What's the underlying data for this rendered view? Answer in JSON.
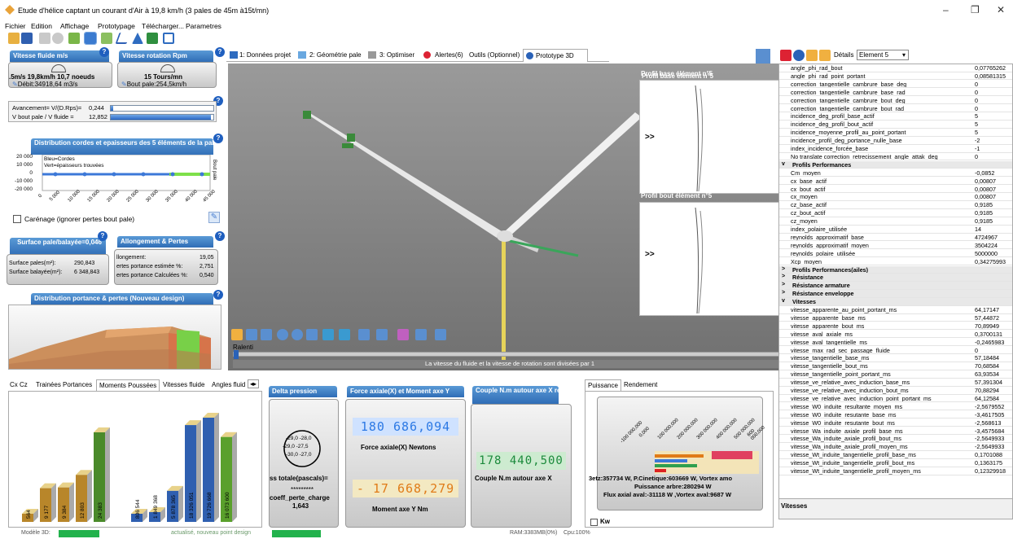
{
  "window": {
    "title": "Etude d'hélice captant un courant d'Air à 19,8 km/h (3 pales de 45m à15t/mn)",
    "minimize": "–",
    "maximize": "❐",
    "close": "✕"
  },
  "menu": [
    "Fichier",
    "Edition",
    "Affichage",
    "Prototypage",
    "Télécharger...",
    "Parametres"
  ],
  "left": {
    "fluid_speed": {
      "title": "Vitesse fluide m/s",
      "line1": ".5m/s 19,8km/h 10,7 noeuds",
      "line2": "Débit:34918,64 m3/s"
    },
    "rot_speed": {
      "title": "Vitesse rotation Rpm",
      "line1": "15 Tours/mn",
      "line2": "Bout pale:254,5km/h"
    },
    "avancement": {
      "label": "Avancement= V/(D.Rps)=",
      "value": "0,244",
      "fill": 0.02
    },
    "vbout": {
      "label": "V bout pale / V fluide =",
      "value": "12,852",
      "fill": 0.98
    },
    "dist_chart": {
      "title": "Distribution cordes et epaisseurs des  5 éléments de la pale decrits par 6 Profils",
      "legend1": "Bleu=Cordes",
      "legend2": "Vert=épaisseurs trouvées",
      "ylabel_right": "Bout pale",
      "yticks": [
        "20 000",
        "10 000",
        "0",
        "-10 000",
        "-20 000"
      ],
      "xticks": [
        "0",
        "5 000",
        "10 000",
        "15 000",
        "20 000",
        "25 000",
        "30 000",
        "35 000",
        "40 000",
        "45 000"
      ]
    },
    "carenage": "Carénage (ignorer pertes bout pale)",
    "surface": {
      "title": "Surface pale/balayée=0,046",
      "pales_label": "Surface pales(m²):",
      "pales_value": "290,843",
      "balayee_label": "Surface balayée(m²):",
      "balayee_value": "6 348,843"
    },
    "allongement": {
      "title": "Allongement & Pertes",
      "l1_label": "llongement:",
      "l1_value": "19,05",
      "l2_label": "ertes portance estimée %:",
      "l2_value": "2,751",
      "l3_label": "ertes portance Calculées %:",
      "l3_value": "0,540"
    },
    "portance": {
      "title": "Distribution portance & pertes (Nouveau design)"
    }
  },
  "tabs_main": [
    {
      "label": "1: Données projet"
    },
    {
      "label": "2: Géométrie pale"
    },
    {
      "label": "3: Optimiser"
    },
    {
      "label": "Alertes(6)"
    },
    {
      "label": "Outils (Optionnel)"
    },
    {
      "label": "Prototype 3D"
    }
  ],
  "viewport": {
    "profil_base": "Profil base élément n°5",
    "profil_bout": "Profil bout élément n°5",
    "arrows": ">>",
    "ralenti": "Ralenti",
    "message": "La vitesse du fluide et la vitesse de rotation sont divisées par 1"
  },
  "bottom_tabs": [
    "Cx Cz",
    "Trainées Portances",
    "Moments Poussées",
    "Vitesses fluide",
    "Angles fluid"
  ],
  "bars": {
    "labels": [
      "564",
      "9 177",
      "9 384",
      "12 803",
      "24 383",
      "806 544",
      "1 849 368",
      "5 878 365",
      "18 326 051",
      "19 726 668",
      "16 073 600"
    ],
    "values": [
      564,
      9177,
      9384,
      12803,
      24383,
      806544,
      1849368,
      5878365,
      18326051,
      19726668,
      16073600
    ]
  },
  "delta": {
    "title": "Delta pression",
    "v1": "-29,0 -28,0",
    "v2": "-29,0 -27,5",
    "v3": "-30,0 -27,0",
    "ss": "ss totale(pascals)=",
    "stars": "*********",
    "coeff": "coeff_perte_charge",
    "coeff_val": "1,643"
  },
  "force": {
    "title": "Force axiale(X) et Moment axe Y",
    "force_val": "180 686,094",
    "force_label": "Force axiale(X) Newtons",
    "moment_val": "- 17 668,279",
    "moment_label": "Moment axe Y Nm"
  },
  "couple": {
    "title": "Couple N.m autour axe X relatif au sens rotation",
    "value": "178 440,500",
    "label": "Couple N.m autour axe X"
  },
  "puissance": {
    "tabs": [
      "Puissance",
      "Rendement"
    ],
    "ticks": [
      "-100 000,000",
      "0,000",
      "100 000,000",
      "200 000,000",
      "300 000,000",
      "400 000,000",
      "500 000,000",
      "600 000,000"
    ],
    "l1": "3etz:357734 W, P.Cinetique:603669 W, Vortex amo",
    "l2": "Puissance arbre:280294 W",
    "l3": "Flux axial aval:-31118 W ,Vortex aval:9687 W",
    "kw": "Kw"
  },
  "props": {
    "details": "Détails",
    "element": "Element 5",
    "footer": "Vitesses",
    "rows": [
      {
        "k": "angle_phi_rad_bout",
        "v": "0,07765262"
      },
      {
        "k": "angle_phi_rad_point_portant",
        "v": "0,08581315"
      },
      {
        "k": "correction_tangentielle_cambrure_base_deg",
        "v": "0"
      },
      {
        "k": "correction_tangentielle_cambrure_base_rad",
        "v": "0"
      },
      {
        "k": "correction_tangentielle_cambrure_bout_deg",
        "v": "0"
      },
      {
        "k": "correction_tangentielle_cambrure_bout_rad",
        "v": "0"
      },
      {
        "k": "incidence_deg_profil_base_actif",
        "v": "5"
      },
      {
        "k": "incidence_deg_profil_bout_actif",
        "v": "5"
      },
      {
        "k": "incidence_moyenne_profil_au_point_portant",
        "v": "5"
      },
      {
        "k": "incidence_profil_deg_portance_nulle_base",
        "v": "-2"
      },
      {
        "k": "index_incidence_forcée_base",
        "v": "-1"
      },
      {
        "k": "No translate correction_retrecissement_angle_attak_deg",
        "v": "0"
      },
      {
        "cat": true,
        "exp": "v",
        "k": "Profils Performances"
      },
      {
        "k": "Cm_moyen",
        "v": "-0,0852"
      },
      {
        "k": "cx_base_actif",
        "v": "0,00807"
      },
      {
        "k": "cx_bout_actif",
        "v": "0,00807"
      },
      {
        "k": "cx_moyen",
        "v": "0,00807"
      },
      {
        "k": "cz_base_actif",
        "v": "0,9185"
      },
      {
        "k": "cz_bout_actif",
        "v": "0,9185"
      },
      {
        "k": "cz_moyen",
        "v": "0,9185"
      },
      {
        "k": "index_polaire_utilisée",
        "v": "14"
      },
      {
        "k": "reynolds_approximatif_base",
        "v": "4724967"
      },
      {
        "k": "reynolds_approximatif_moyen",
        "v": "3504224"
      },
      {
        "k": "reynolds_polaire_utilisée",
        "v": "5000000"
      },
      {
        "k": "Xcp_moyen",
        "v": "0,34275993"
      },
      {
        "cat": true,
        "exp": ">",
        "k": "Profils Performances(ailes)"
      },
      {
        "cat": true,
        "exp": ">",
        "k": "Résistance"
      },
      {
        "cat": true,
        "exp": ">",
        "k": "Résistance armature"
      },
      {
        "cat": true,
        "exp": ">",
        "k": "Résistance enveloppe"
      },
      {
        "cat": true,
        "exp": "v",
        "k": "Vitesses"
      },
      {
        "k": "vitesse_apparente_au_point_portant_ms",
        "v": "64,17147"
      },
      {
        "k": "vitesse_apparente_base_ms",
        "v": "57,44872"
      },
      {
        "k": "vitesse_apparente_bout_ms",
        "v": "70,89949"
      },
      {
        "k": "vitesse_aval_axiale_ms",
        "v": "0,3700131"
      },
      {
        "k": "vitesse_aval_tangentielle_ms",
        "v": "-0,2465983"
      },
      {
        "k": "vitesse_max_rad_sec_passage_fluide",
        "v": "0"
      },
      {
        "k": "vitesse_tangentielle_base_ms",
        "v": "57,18484"
      },
      {
        "k": "vitesse_tangentielle_bout_ms",
        "v": "70,68584"
      },
      {
        "k": "vitesse_tangentielle_point_portant_ms",
        "v": "63,93534"
      },
      {
        "k": "vitesse_ve_relative_avec_induction_base_ms",
        "v": "57,391304"
      },
      {
        "k": "vitesse_ve_relative_avec_induction_bout_ms",
        "v": "70,88294"
      },
      {
        "k": "vitesse_ve_relative_avec_induction_point_portant_ms",
        "v": "64,12584"
      },
      {
        "k": "vitesse_W0_induite_resultante_moyen_ms",
        "v": "-2,5679552"
      },
      {
        "k": "vitesse_W0_induite_resutante_base_ms",
        "v": "-3,4617505"
      },
      {
        "k": "vitesse_W0_induite_resutante_bout_ms",
        "v": "-2,568613"
      },
      {
        "k": "vitesse_Wa_induite_axiale_profil_base_ms",
        "v": "-3,4575684"
      },
      {
        "k": "vitesse_Wa_induite_axiale_profil_bout_ms",
        "v": "-2,5649933"
      },
      {
        "k": "vitesse_Wa_induite_axiale_profil_moyen_ms",
        "v": "-2,5649933"
      },
      {
        "k": "vitesse_Wt_induite_tangentielle_profil_base_ms",
        "v": "0,1701088"
      },
      {
        "k": "vitesse_Wt_induite_tangentielle_profil_bout_ms",
        "v": "0,1363175"
      },
      {
        "k": "vitesse_Wt_induite_tangentielle_profil_moyen_ms",
        "v": "0,12329918"
      }
    ]
  },
  "status": {
    "model": "Modèle 3D:",
    "update": "actualisé, nouveau point design",
    "ram": "RAM:3383MB(0%)",
    "cpu": "Cpu:100%"
  }
}
